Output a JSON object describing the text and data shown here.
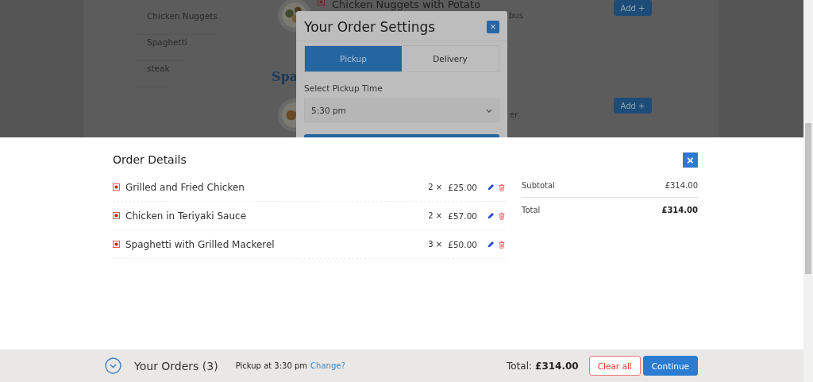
{
  "background_page": {
    "menu_items": [
      "Chicken Nuggets",
      "Spaghetti",
      "steak"
    ],
    "dish": {
      "title": "Chicken Nuggets with Potato",
      "description": "bus"
    },
    "section_heading": "Spa",
    "dish_2": {
      "description": "er"
    },
    "add_buttons": [
      "Add +",
      "Add +"
    ]
  },
  "order_settings_dialog": {
    "title": "Your Order Settings",
    "close": "×",
    "tabs": [
      {
        "label": "Pickup",
        "selected": true
      },
      {
        "label": "Delivery",
        "selected": false
      }
    ],
    "time_label": "Select Pickup Time",
    "time_value": "5:30 pm"
  },
  "order_details": {
    "title": "Order Details",
    "close": "×",
    "items": [
      {
        "name": "Grilled and Fried Chicken",
        "quantity": "2 ×",
        "price": "£25.00"
      },
      {
        "name": "Chicken in Teriyaki Sauce",
        "quantity": "2 ×",
        "price": "£57.00"
      },
      {
        "name": "Spaghetti with Grilled Mackerel",
        "quantity": "3 ×",
        "price": "£50.00"
      }
    ],
    "summary": [
      {
        "label": "Subtotal",
        "value": "£314.00",
        "kind": "subtotal"
      },
      {
        "label": "Total",
        "value": "£314.00",
        "kind": "total"
      }
    ]
  },
  "footer": {
    "title": "Your Orders (3)",
    "pickup": "Pickup at 3:30 pm",
    "change_link": "Change?",
    "total_label": "Total:",
    "total_value": "£314.00",
    "buttons": [
      {
        "label": "Clear all",
        "kind": "outline"
      },
      {
        "label": "Continue",
        "kind": "primary"
      }
    ]
  }
}
